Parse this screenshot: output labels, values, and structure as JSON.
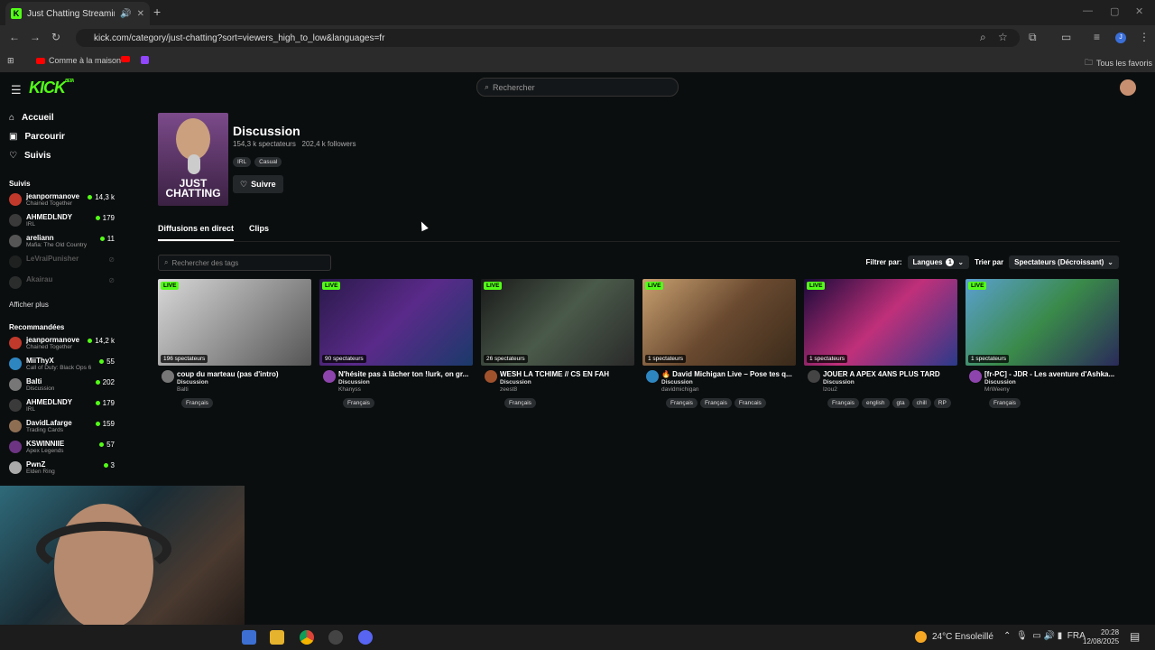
{
  "browser": {
    "tab_title": "Just Chatting Streaming - I",
    "url": "kick.com/category/just-chatting?sort=viewers_high_to_low&languages=fr",
    "bookmarks": [
      "Comme à la maison"
    ],
    "all_bookmarks": "Tous les favoris"
  },
  "header": {
    "search_placeholder": "Rechercher",
    "logo": "KICK",
    "beta": "BETA"
  },
  "nav": {
    "home": "Accueil",
    "browse": "Parcourir",
    "following": "Suivis"
  },
  "sidebar": {
    "following_title": "Suivis",
    "following": [
      {
        "name": "jeanpormanove",
        "game": "Chained Together",
        "viewers": "14,3 k",
        "color": "#c0392b",
        "online": true
      },
      {
        "name": "AHMEDLNDY",
        "game": "IRL",
        "viewers": "179",
        "color": "#3a3a3a",
        "online": true
      },
      {
        "name": "arelian​n",
        "game": "Mafia: The Old Country",
        "viewers": "11",
        "color": "#555",
        "online": true
      },
      {
        "name": "LeVraiPunisher",
        "game": "",
        "viewers": "",
        "color": "#444",
        "online": false
      },
      {
        "name": "Akairau",
        "game": "",
        "viewers": "",
        "color": "#666",
        "online": false
      }
    ],
    "show_more": "Afficher plus",
    "recommended_title": "Recommandées",
    "recommended": [
      {
        "name": "jeanpormanove",
        "game": "Chained Together",
        "viewers": "14,2 k",
        "color": "#c0392b"
      },
      {
        "name": "MiiThyX",
        "game": "Call of Duty: Black Ops 6",
        "viewers": "55",
        "color": "#2e86c1"
      },
      {
        "name": "Balti",
        "game": "Discussion",
        "viewers": "202",
        "color": "#777"
      },
      {
        "name": "AHMEDLNDY",
        "game": "IRL",
        "viewers": "179",
        "color": "#3a3a3a"
      },
      {
        "name": "DavidLafarge",
        "game": "Trading Cards",
        "viewers": "159",
        "color": "#8e6e53"
      },
      {
        "name": "KSWINNIIE",
        "game": "Apex Legends",
        "viewers": "57",
        "color": "#6c3483"
      },
      {
        "name": "PwnZ",
        "game": "Elden Ring",
        "viewers": "3",
        "color": "#aaa"
      }
    ]
  },
  "category": {
    "hero_text": "JUST CHATTING",
    "title": "Discussion",
    "viewers": "154,3 k spectateurs",
    "followers": "202,4 k followers",
    "tags": [
      "IRL",
      "Casual"
    ],
    "follow_label": "Suivre"
  },
  "tabs": [
    "Diffusions en direct",
    "Clips"
  ],
  "filters": {
    "tag_search_placeholder": "Rechercher des tags",
    "filter_by": "Filtrer par:",
    "languages": "Langues",
    "languages_count": "1",
    "sort_by": "Trier par",
    "sort_value": "Spectateurs (Décroissant)"
  },
  "live_label": "LIVE",
  "streams": [
    {
      "viewers": "196 spectateurs",
      "title": "coup du marteau (pas d'intro)",
      "category": "Discussion",
      "user": "Balti",
      "tags": [
        "Français"
      ],
      "thumb": "linear-gradient(135deg,#d8d8d8,#8a8a8a 60%,#555)",
      "avatar": "#777"
    },
    {
      "viewers": "90 spectateurs",
      "title": "N'hésite pas à lâcher ton !lurk, on gr...",
      "category": "Discussion",
      "user": "Khanyss",
      "tags": [
        "Français"
      ],
      "thumb": "linear-gradient(135deg,#2a1a4a,#5a2a8a 50%,#1a3a6a)",
      "avatar": "#8e44ad"
    },
    {
      "viewers": "26 spectateurs",
      "title": "WESH LA TCHIME // CS EN FAH",
      "category": "Discussion",
      "user": "zeest8",
      "tags": [
        "Français"
      ],
      "thumb": "linear-gradient(135deg,#1a1a1a,#4a5a4a 50%,#2a2a2a)",
      "avatar": "#a0522d"
    },
    {
      "viewers": "1 spectateurs",
      "title": "🔥 David Michigan Live – Pose tes q...",
      "category": "Discussion",
      "user": "davidmichigan",
      "tags": [
        "Français",
        "Français",
        "Francais"
      ],
      "thumb": "linear-gradient(135deg,#c8a070,#6a4a30 50%,#3a2a1a)",
      "avatar": "#2e86c1"
    },
    {
      "viewers": "1 spectateurs",
      "title": "JOUER A APEX 4ANS PLUS TARD",
      "category": "Discussion",
      "user": "Izou2",
      "tags": [
        "Français",
        "english",
        "gta",
        "chill",
        "RP"
      ],
      "thumb": "linear-gradient(135deg,#1a0a3a,#c0307a 50%,#2a3a8a)",
      "avatar": "#444"
    },
    {
      "viewers": "1 spectateurs",
      "title": "[fr-PC] - JDR - Les aventure d'Ashka...",
      "category": "Discussion",
      "user": "MrWeeny",
      "tags": [
        "Français"
      ],
      "thumb": "linear-gradient(135deg,#5aa0d0,#3a8a4a 50%,#2a2a5a)",
      "avatar": "#8e44ad"
    }
  ],
  "taskbar": {
    "weather": "24°C  Ensoleillé",
    "lang": "FRA",
    "time": "20:28",
    "date": "12/08/2025"
  }
}
